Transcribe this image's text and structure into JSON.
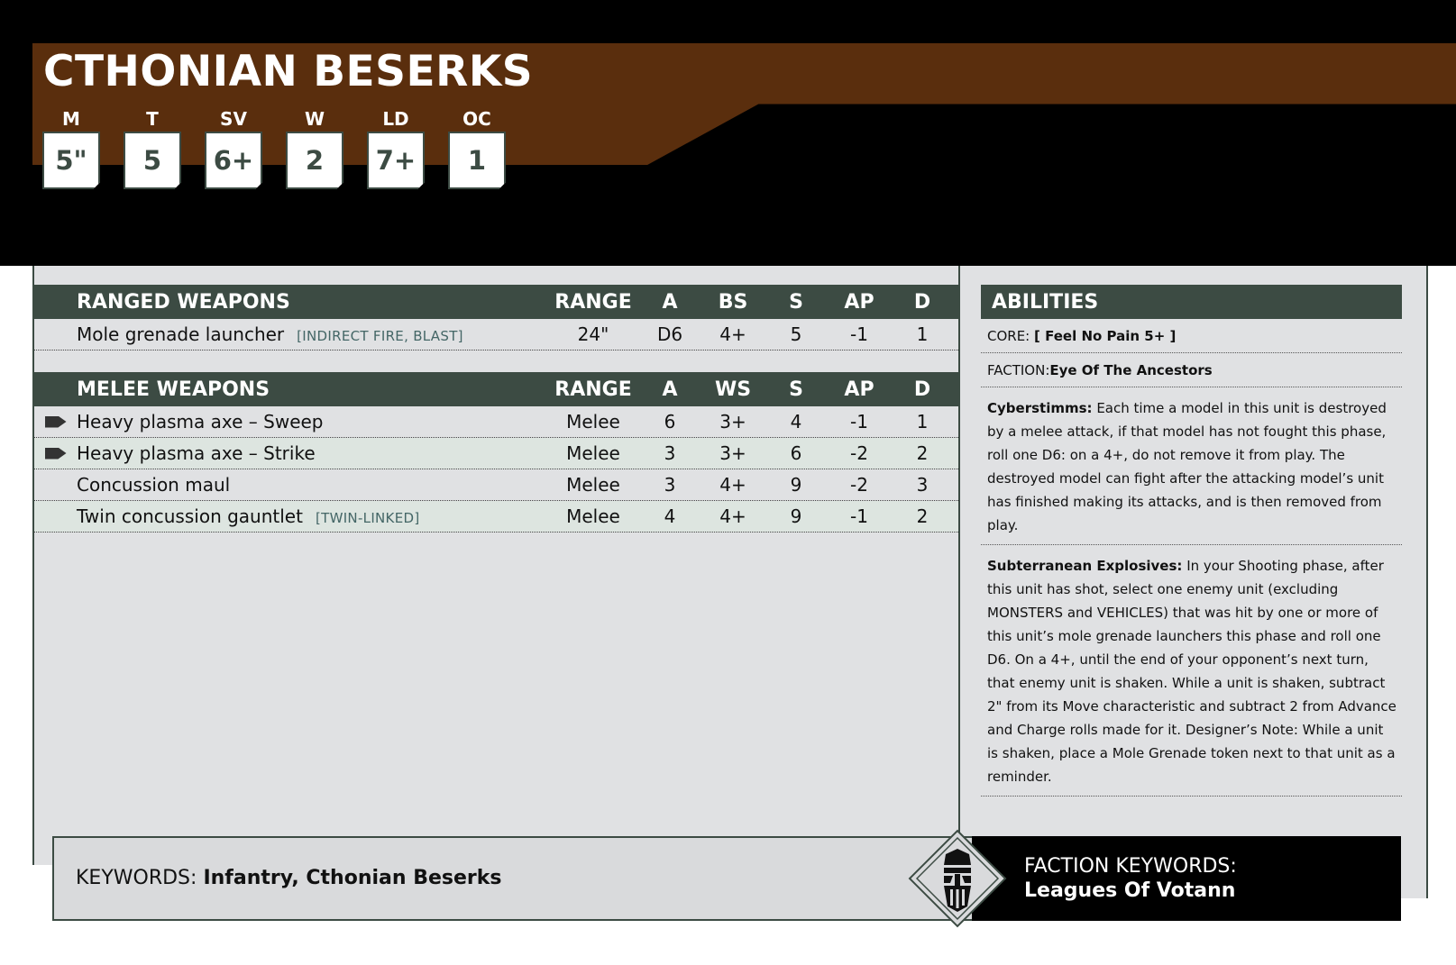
{
  "unit": {
    "name": "CTHONIAN BESERKS"
  },
  "stats": [
    {
      "label": "M",
      "value": "5\""
    },
    {
      "label": "T",
      "value": "5"
    },
    {
      "label": "SV",
      "value": "6+"
    },
    {
      "label": "W",
      "value": "2"
    },
    {
      "label": "LD",
      "value": "7+"
    },
    {
      "label": "OC",
      "value": "1"
    }
  ],
  "ranged": {
    "title": "RANGED WEAPONS",
    "headers": [
      "RANGE",
      "A",
      "BS",
      "S",
      "AP",
      "D"
    ],
    "rows": [
      {
        "name": "Mole grenade launcher",
        "keywords": "[INDIRECT FIRE, BLAST]",
        "range": "24\"",
        "a": "D6",
        "skill": "4+",
        "s": "5",
        "ap": "-1",
        "d": "1"
      }
    ]
  },
  "melee": {
    "title": "MELEE WEAPONS",
    "headers": [
      "RANGE",
      "A",
      "WS",
      "S",
      "AP",
      "D"
    ],
    "rows": [
      {
        "name": "Heavy plasma axe – Sweep",
        "keywords": "",
        "range": "Melee",
        "a": "6",
        "skill": "3+",
        "s": "4",
        "ap": "-1",
        "d": "1"
      },
      {
        "name": "Heavy plasma axe – Strike",
        "keywords": "",
        "range": "Melee",
        "a": "3",
        "skill": "3+",
        "s": "6",
        "ap": "-2",
        "d": "2"
      },
      {
        "name": "Concussion maul",
        "keywords": "",
        "range": "Melee",
        "a": "3",
        "skill": "4+",
        "s": "9",
        "ap": "-2",
        "d": "3"
      },
      {
        "name": "Twin concussion gauntlet",
        "keywords": "[TWIN-LINKED]",
        "range": "Melee",
        "a": "4",
        "skill": "4+",
        "s": "9",
        "ap": "-1",
        "d": "2"
      }
    ]
  },
  "abilities": {
    "title": "ABILITIES",
    "core_label": "CORE:",
    "core_value": "[ Feel No Pain 5+ ]",
    "faction_label": "FACTION:",
    "faction_value": "Eye Of The Ancestors",
    "items": [
      {
        "name": "Cyberstimms:",
        "text": "Each time a model in this unit is destroyed by a melee attack, if that model has not fought this phase, roll one D6: on a 4+, do not remove it from play. The destroyed model can fight after the attacking model’s unit has finished making its attacks, and is then removed from play."
      },
      {
        "name": "Subterranean Explosives:",
        "text": "In your Shooting phase, after this unit has shot, select one enemy unit (excluding MONSTERS and VEHICLES) that was hit by one or more of this unit’s mole grenade launchers this phase and roll one D6. On a 4+, until the end of your opponent’s next turn, that enemy unit is shaken. While a unit is shaken, subtract 2\" from its Move characteristic and subtract 2 from Advance and Charge rolls made for it. Designer’s Note: While a unit is shaken, place a Mole Grenade token next to that unit as a reminder."
      }
    ]
  },
  "keywords": {
    "label": "KEYWORDS:",
    "value": "Infantry, Cthonian Beserks"
  },
  "faction_keywords": {
    "label": "FACTION KEYWORDS:",
    "value": "Leagues Of Votann"
  },
  "colors": {
    "band": "#5a2e0d",
    "header": "#3c4b43",
    "panel": "#e0e1e3"
  }
}
